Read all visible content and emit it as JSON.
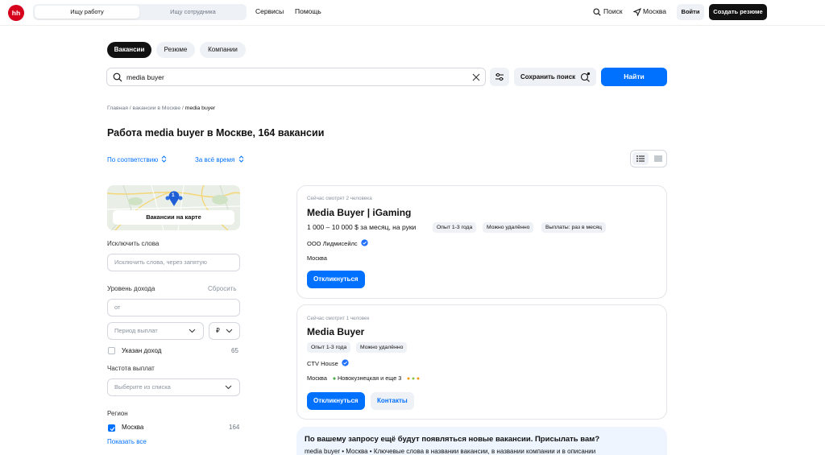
{
  "header": {
    "logo": "hh",
    "segments": [
      "Ищу работу",
      "Ищу сотрудника"
    ],
    "links": [
      "Сервисы",
      "Помощь"
    ],
    "search_label": "Поиск",
    "city": "Москва",
    "login": "Войти",
    "create_resume": "Создать резюме"
  },
  "tabs": [
    "Вакансии",
    "Резюме",
    "Компании"
  ],
  "search": {
    "value": "media buyer",
    "save_label": "Сохранить поиск",
    "find_label": "Найти"
  },
  "breadcrumb": [
    "Главная",
    "вакансии в Москве",
    "media buyer"
  ],
  "page_title": "Работа media buyer в Москве, 164 вакансии",
  "sort": {
    "relevance": "По соответствию",
    "period": "За всё время"
  },
  "sidebar": {
    "map_badge": "1",
    "map_button": "Вакансии на карте",
    "exclude_label": "Исключить слова",
    "exclude_placeholder": "Исключить слова, через запятую",
    "income_label": "Уровень дохода",
    "reset": "Сбросить",
    "income_from": "от",
    "period_placeholder": "Период выплат",
    "currency": "₽",
    "salary_specified": "Указан доход",
    "salary_specified_count": "65",
    "frequency_label": "Частота выплат",
    "frequency_placeholder": "Выберите из списка",
    "region_label": "Регион",
    "region_item": "Москва",
    "region_count": "164",
    "show_all": "Показать все"
  },
  "vacancies": [
    {
      "viewers": "Сейчас смотрят 2 человека",
      "title": "Media Buyer | iGaming",
      "salary": "1 000 – 10 000 $ за месяц, на руки",
      "tags": [
        "Опыт 1-3 года",
        "Можно удалённо",
        "Выплаты: раз в месяц"
      ],
      "company": "ООО Лидмисейлс",
      "city": "Москва",
      "respond": "Откликнуться"
    },
    {
      "viewers": "Сейчас смотрит 1 человек",
      "title": "Media Buyer",
      "tags": [
        "Опыт 1-3 года",
        "Можно удалённо"
      ],
      "company": "CTV House",
      "city": "Москва",
      "metro": "Новокузнецкая и еще 3",
      "respond": "Откликнуться",
      "contacts": "Контакты"
    }
  ],
  "promo": {
    "title": "По вашему запросу ещё будут появляться новые вакансии. Присылать вам?",
    "text": "media buyer • Москва • Ключевые слова в названии вакансии, в названии компании и в описании"
  },
  "colors": {
    "brand": "#d6001c",
    "accent": "#0070ff",
    "verified": "#1e6fff"
  }
}
